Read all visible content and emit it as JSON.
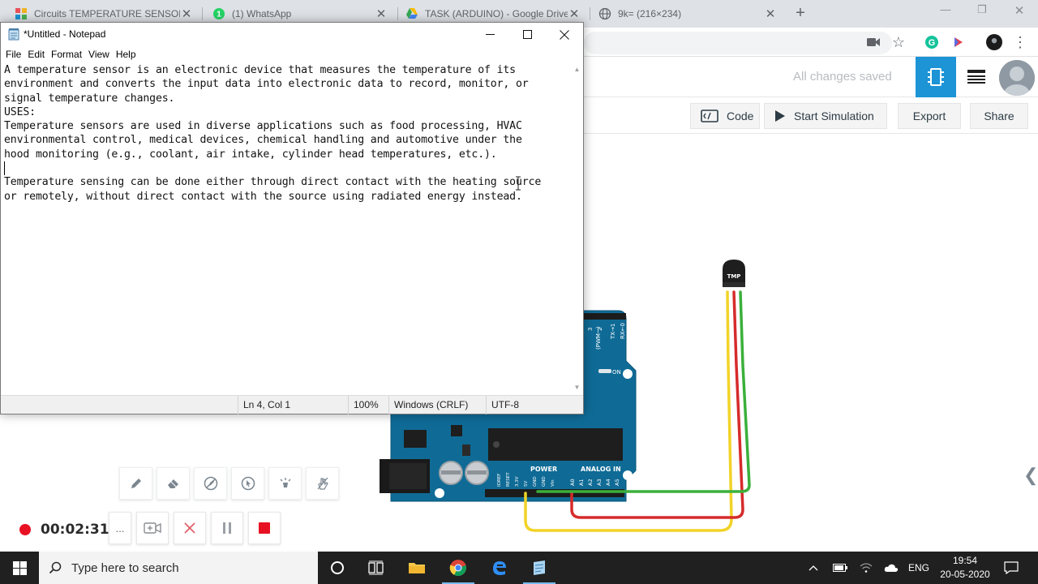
{
  "browser": {
    "tabs": [
      {
        "label": "Circuits TEMPERATURE SENSOR |",
        "icon": "tinkercad-icon",
        "active": true
      },
      {
        "label": "(1) WhatsApp",
        "icon": "whatsapp-icon"
      },
      {
        "label": "TASK (ARDUINO) - Google Drive",
        "icon": "google-drive-icon"
      },
      {
        "label": "9k= (216×234)",
        "icon": "globe-icon"
      }
    ],
    "new_tab_label": "+"
  },
  "tinkercad": {
    "save_status": "All changes saved",
    "toolbar": {
      "code_label": "Code",
      "simulation_label": "Start Simulation",
      "export_label": "Export",
      "share_label": "Share"
    },
    "board_labels": {
      "power": "POWER",
      "analog_in": "ANALOG IN",
      "on": "ON",
      "sensor": "TMP",
      "pins_power": [
        "IOREF",
        "RESET",
        "3.3V",
        "5V",
        "GND",
        "GND",
        "Vin"
      ],
      "pins_analog": [
        "A0",
        "A1",
        "A2",
        "A3",
        "A4",
        "A5"
      ],
      "pins_digital": [
        "(PWM~)",
        "3",
        "2",
        "TX→1",
        "RX←0"
      ]
    },
    "wire_colors": {
      "yellow": "#f2d327",
      "red": "#d62b2b",
      "green": "#3bb03b"
    }
  },
  "recorder": {
    "elapsed": "00:02:31",
    "more_label": "..."
  },
  "notepad": {
    "title": "*Untitled - Notepad",
    "menu": [
      "File",
      "Edit",
      "Format",
      "View",
      "Help"
    ],
    "text_lines": [
      "A temperature sensor is an electronic device that measures the temperature of its",
      "environment and converts the input data into electronic data to record, monitor, or",
      "signal temperature changes.",
      "USES:",
      "Temperature sensors are used in diverse applications such as food processing, HVAC",
      "environmental control, medical devices, chemical handling and automotive under the",
      "hood monitoring (e.g., coolant, air intake, cylinder head temperatures, etc.).",
      "",
      "Temperature sensing can be done either through direct contact with the heating source",
      "or remotely, without direct contact with the source using radiated energy instead."
    ],
    "status": {
      "position": "Ln 4, Col 1",
      "zoom": "100%",
      "line_ending": "Windows (CRLF)",
      "encoding": "UTF-8"
    }
  },
  "taskbar": {
    "search_placeholder": "Type here to search",
    "language": "ENG",
    "time": "19:54",
    "date": "20-05-2020"
  }
}
